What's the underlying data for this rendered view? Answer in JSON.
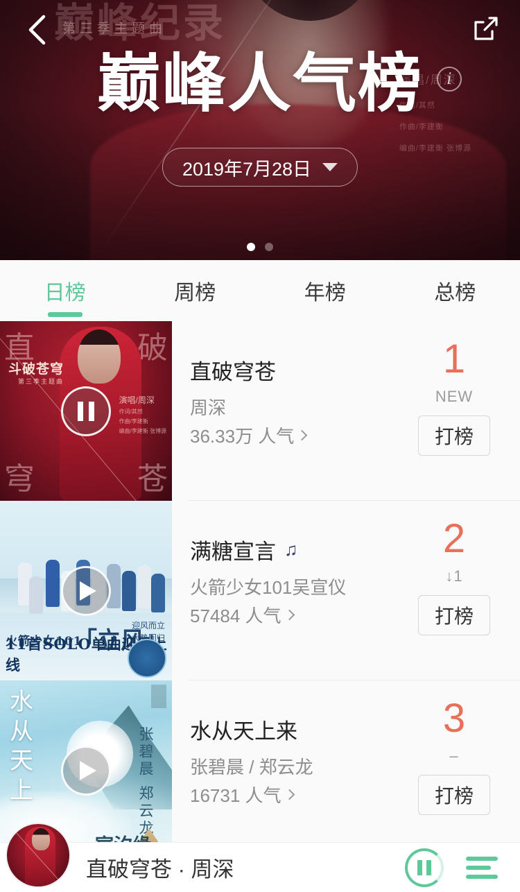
{
  "header": {
    "back_icon": "chevron-left-icon",
    "share_icon": "share-external-icon",
    "title": "巅峰人气榜",
    "info_icon": "info-circle-icon",
    "date_label": "2019年7月28日",
    "date_caret_icon": "caret-down-icon",
    "banner_ghost_title": "巅峰纪录",
    "banner_ghost_sub": "第三季主题曲",
    "banner_credit_main": "演唱/周深",
    "banner_credit_1": "作词/其然",
    "banner_credit_2": "作曲/李建衡",
    "banner_credit_3": "编曲/李建衡  张博源",
    "dots": [
      {
        "active": true
      },
      {
        "active": false
      }
    ]
  },
  "tabs": [
    {
      "label": "日榜",
      "active": true
    },
    {
      "label": "周榜",
      "active": false
    },
    {
      "label": "年榜",
      "active": false
    },
    {
      "label": "总榜",
      "active": false
    }
  ],
  "accent_colors": {
    "tab_active": "#5ec89a",
    "rank_number": "#e8705a",
    "player_accent": "#5ec89a",
    "mv_icon": "#3a4070"
  },
  "list": [
    {
      "title": "直破穹苍",
      "artist": "周深",
      "hot": "36.33万 人气",
      "hot_chevron_icon": "chevron-right-icon",
      "rank": "1",
      "trend": "NEW",
      "action_label": "打榜",
      "play_state": "pause",
      "play_icon": "pause-icon",
      "has_mv": false,
      "cover": {
        "corner_tl": "直",
        "corner_tr": "破",
        "corner_bl": "穹",
        "corner_br": "苍",
        "badge": "斗破苍穹",
        "badge_sub": "第三季主题曲",
        "credit_main": "演唱/周深",
        "credit_1": "作词/其然",
        "credit_2": "作曲/李建衡",
        "credit_3": "编曲/李建衡  张博源"
      }
    },
    {
      "title": "满糖宣言",
      "artist": "火箭少女101吴宣仪",
      "hot": "57484 人气",
      "hot_chevron_icon": "chevron-right-icon",
      "rank": "2",
      "trend": "↓1",
      "action_label": "打榜",
      "play_state": "play",
      "play_icon": "play-icon",
      "has_mv": true,
      "mv_icon": "music-note-icon",
      "cover": {
        "group": "火箭少女101",
        "big": "「立风」",
        "side_1": "迎风而立",
        "side_2": "大势回归",
        "bottom": "11首SOLO单曲迎风上线"
      }
    },
    {
      "title": "水从天上来",
      "artist": "张碧晨 / 郑云龙",
      "hot": "16731 人气",
      "hot_chevron_icon": "chevron-right-icon",
      "rank": "3",
      "trend": "–",
      "action_label": "打榜",
      "play_state": "play",
      "play_icon": "play-icon",
      "has_mv": false,
      "cover": {
        "vertical_title": "水从天上来",
        "artists": "张碧晨 郑云龙",
        "logo": "宸汐缘"
      }
    }
  ],
  "player": {
    "avatar_icon": "album-avatar",
    "now_playing": "直破穹苍 · 周深",
    "play_icon": "pause-icon",
    "playlist_icon": "playlist-icon"
  }
}
